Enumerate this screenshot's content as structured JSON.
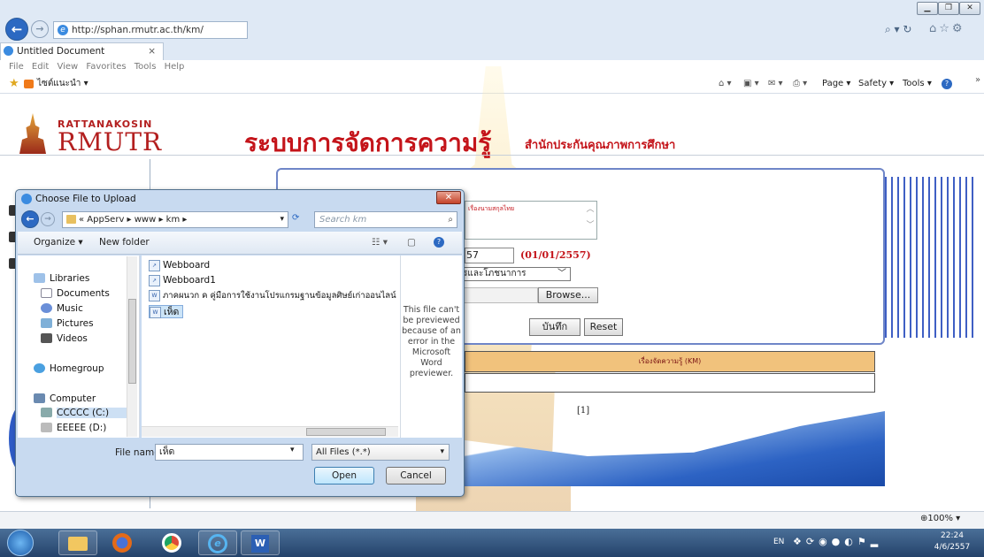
{
  "browser": {
    "url": "http://sphan.rmutr.ac.th/km/",
    "tab_title": "Untitled Document",
    "menu": [
      "File",
      "Edit",
      "View",
      "Favorites",
      "Tools",
      "Help"
    ],
    "favorites_label": "ไซต์แนะนำ ▾",
    "commandbar": {
      "page": "Page ▾",
      "safety": "Safety ▾",
      "tools": "Tools ▾"
    },
    "zoom": "100%"
  },
  "site": {
    "logo_top": "RATTANAKOSIN",
    "logo_mark": "RMUTR",
    "title": "ระบบการจัดการความรู้",
    "subtitle": "สำนักประกันคุณภาพการศึกษา"
  },
  "form": {
    "textarea_text": "เรื่องนามสกุลไทย",
    "date_value": "57",
    "date_hint": "(01/01/2557)",
    "category_selected": "รและโภชนาการ",
    "browse_label": "Browse...",
    "save_label": "บันทึก",
    "reset_label": "Reset"
  },
  "km_table": {
    "header": "เรื่องจัดความรู้ (KM)"
  },
  "pager": "[1]",
  "dialog": {
    "title": "Choose File to Upload",
    "breadcrumb": "« AppServ ▸ www ▸ km ▸",
    "search_placeholder": "Search km",
    "organize": "Organize ▾",
    "new_folder": "New folder",
    "nav_items": [
      {
        "label": "Libraries",
        "icon": "libraries-icon"
      },
      {
        "label": "Documents",
        "icon": "documents-icon"
      },
      {
        "label": "Music",
        "icon": "music-icon"
      },
      {
        "label": "Pictures",
        "icon": "pictures-icon"
      },
      {
        "label": "Videos",
        "icon": "videos-icon"
      },
      {
        "label": "Homegroup",
        "icon": "homegroup-icon"
      },
      {
        "label": "Computer",
        "icon": "computer-icon"
      },
      {
        "label": "CCCCC (C:)",
        "icon": "drive-c-icon"
      },
      {
        "label": "EEEEE (D:)",
        "icon": "drive-d-icon"
      }
    ],
    "files": [
      {
        "name": "Webboard",
        "icon": "shortcut-icon"
      },
      {
        "name": "Webboard1",
        "icon": "shortcut-icon"
      },
      {
        "name": "ภาคผนวก ค คู่มือการใช้งานโปรแกรมฐานข้อมูลศิษย์เก่าออนไลน์",
        "icon": "word-doc-icon"
      },
      {
        "name": "เห็ด",
        "icon": "word-doc-icon"
      }
    ],
    "preview_text": "This file can't be previewed because of an error in the Microsoft Word previewer.",
    "filename_label": "File name:",
    "filename_value": "เห็ด",
    "filetype": "All Files (*.*)",
    "open_label": "Open",
    "cancel_label": "Cancel"
  },
  "taskbar": {
    "lang": "EN",
    "time": "22:24",
    "date": "4/6/2557"
  }
}
